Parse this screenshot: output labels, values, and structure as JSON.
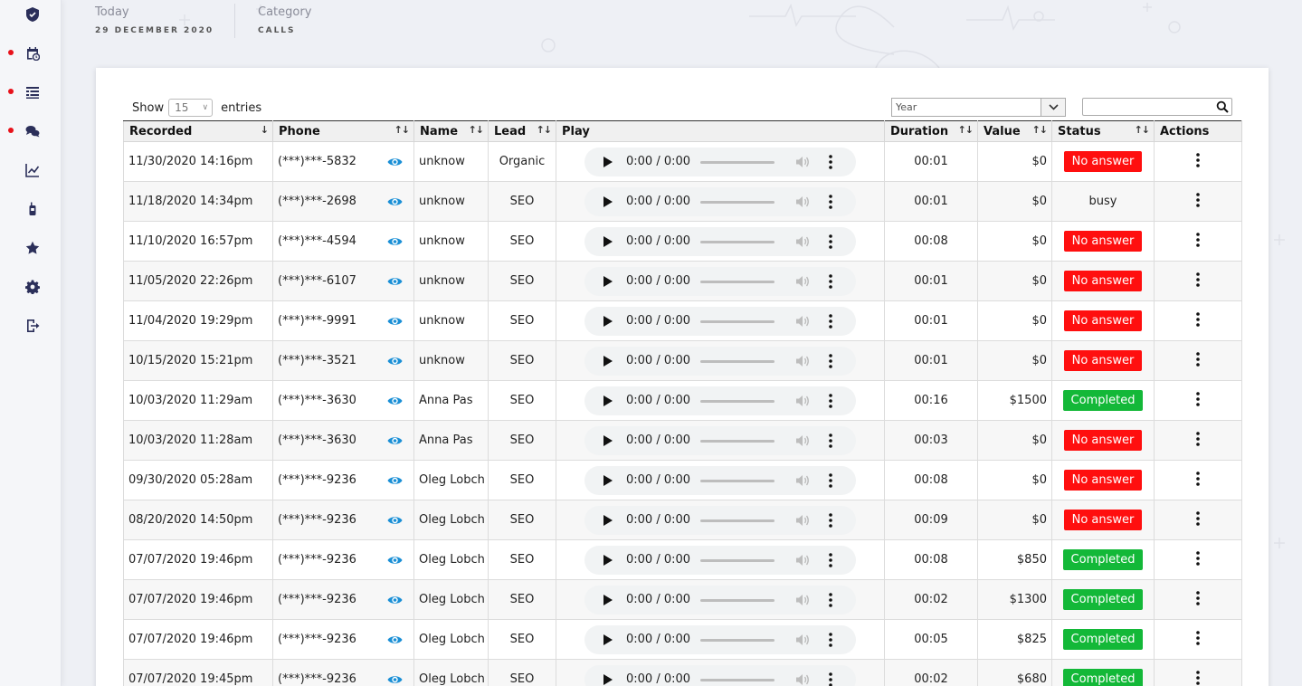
{
  "header": {
    "today_label": "Today",
    "today_value": "29 DECEMBER 2020",
    "category_label": "Category",
    "category_value": "CALLS"
  },
  "sidebar": {
    "items": [
      {
        "icon": "shield-icon",
        "dot": false
      },
      {
        "icon": "calendar-clock-icon",
        "dot": true
      },
      {
        "icon": "list-icon",
        "dot": true
      },
      {
        "icon": "chat-icon",
        "dot": true
      },
      {
        "icon": "chart-line-icon",
        "dot": false
      },
      {
        "icon": "walkie-talkie-icon",
        "dot": false
      },
      {
        "icon": "star-icon",
        "dot": false
      },
      {
        "icon": "gear-icon",
        "dot": false
      },
      {
        "icon": "logout-icon",
        "dot": false
      }
    ],
    "dot_color": "#e8121b"
  },
  "controls": {
    "show_label": "Show",
    "entries_value": "15",
    "entries_label": "entries",
    "year_placeholder": "Year",
    "search_value": ""
  },
  "table": {
    "headers": [
      "Recorded",
      "Phone",
      "Name",
      "Lead",
      "Play",
      "Duration",
      "Value",
      "Status",
      "Actions"
    ],
    "player_time": "0:00 / 0:00",
    "rows": [
      {
        "recorded": "11/30/2020 14:16pm",
        "phone": "(***)***-5832",
        "name": "unknow",
        "lead": "Organic",
        "duration": "00:01",
        "value": "$0",
        "status": "No answer",
        "status_type": "red"
      },
      {
        "recorded": "11/18/2020 14:34pm",
        "phone": "(***)***-2698",
        "name": "unknow",
        "lead": "SEO",
        "duration": "00:01",
        "value": "$0",
        "status": "busy",
        "status_type": "text"
      },
      {
        "recorded": "11/10/2020 16:57pm",
        "phone": "(***)***-4594",
        "name": "unknow",
        "lead": "SEO",
        "duration": "00:08",
        "value": "$0",
        "status": "No answer",
        "status_type": "red"
      },
      {
        "recorded": "11/05/2020 22:26pm",
        "phone": "(***)***-6107",
        "name": "unknow",
        "lead": "SEO",
        "duration": "00:01",
        "value": "$0",
        "status": "No answer",
        "status_type": "red"
      },
      {
        "recorded": "11/04/2020 19:29pm",
        "phone": "(***)***-9991",
        "name": "unknow",
        "lead": "SEO",
        "duration": "00:01",
        "value": "$0",
        "status": "No answer",
        "status_type": "red"
      },
      {
        "recorded": "10/15/2020 15:21pm",
        "phone": "(***)***-3521",
        "name": "unknow",
        "lead": "SEO",
        "duration": "00:01",
        "value": "$0",
        "status": "No answer",
        "status_type": "red"
      },
      {
        "recorded": "10/03/2020 11:29am",
        "phone": "(***)***-3630",
        "name": "Anna Pas",
        "lead": "SEO",
        "duration": "00:16",
        "value": "$1500",
        "status": "Completed",
        "status_type": "green"
      },
      {
        "recorded": "10/03/2020 11:28am",
        "phone": "(***)***-3630",
        "name": "Anna Pas",
        "lead": "SEO",
        "duration": "00:03",
        "value": "$0",
        "status": "No answer",
        "status_type": "red"
      },
      {
        "recorded": "09/30/2020 05:28am",
        "phone": "(***)***-9236",
        "name": "Oleg Lobch",
        "lead": "SEO",
        "duration": "00:08",
        "value": "$0",
        "status": "No answer",
        "status_type": "red"
      },
      {
        "recorded": "08/20/2020 14:50pm",
        "phone": "(***)***-9236",
        "name": "Oleg Lobch",
        "lead": "SEO",
        "duration": "00:09",
        "value": "$0",
        "status": "No answer",
        "status_type": "red"
      },
      {
        "recorded": "07/07/2020 19:46pm",
        "phone": "(***)***-9236",
        "name": "Oleg Lobch",
        "lead": "SEO",
        "duration": "00:08",
        "value": "$850",
        "status": "Completed",
        "status_type": "green"
      },
      {
        "recorded": "07/07/2020 19:46pm",
        "phone": "(***)***-9236",
        "name": "Oleg Lobch",
        "lead": "SEO",
        "duration": "00:02",
        "value": "$1300",
        "status": "Completed",
        "status_type": "green"
      },
      {
        "recorded": "07/07/2020 19:46pm",
        "phone": "(***)***-9236",
        "name": "Oleg Lobch",
        "lead": "SEO",
        "duration": "00:05",
        "value": "$825",
        "status": "Completed",
        "status_type": "green"
      },
      {
        "recorded": "07/07/2020 19:45pm",
        "phone": "(***)***-9236",
        "name": "Oleg Lobch",
        "lead": "SEO",
        "duration": "00:02",
        "value": "$680",
        "status": "Completed",
        "status_type": "green"
      }
    ]
  },
  "colors": {
    "status_red": "#ff0f0f",
    "status_green": "#13b838",
    "eye_icon": "#1a8fd6",
    "sidebar_icon": "#2b2f5a"
  }
}
